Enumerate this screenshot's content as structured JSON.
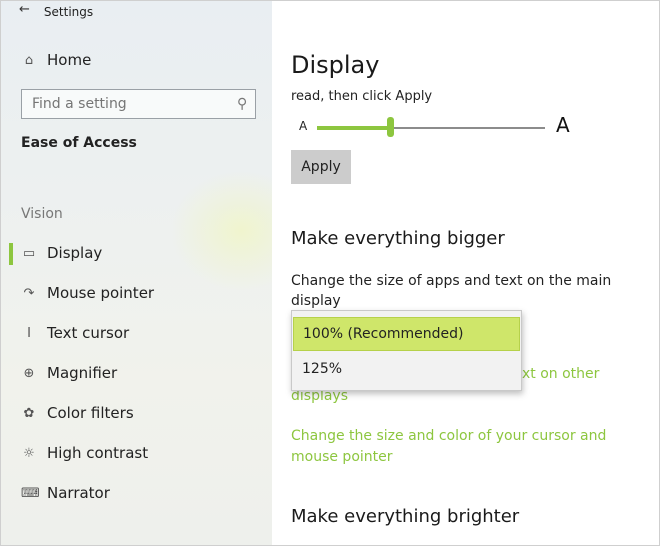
{
  "window": {
    "title": "Settings",
    "back_icon": "back-arrow-icon"
  },
  "sidebar": {
    "home_label": "Home",
    "search": {
      "placeholder": "Find a setting",
      "icon": "search-icon"
    },
    "section_label": "Ease of Access",
    "group_label": "Vision",
    "items": [
      {
        "label": "Display",
        "icon": "monitor-icon",
        "active": true
      },
      {
        "label": "Mouse pointer",
        "icon": "mouse-pointer-icon"
      },
      {
        "label": "Text cursor",
        "icon": "text-cursor-icon"
      },
      {
        "label": "Magnifier",
        "icon": "magnifier-icon"
      },
      {
        "label": "Color filters",
        "icon": "color-filters-icon"
      },
      {
        "label": "High contrast",
        "icon": "high-contrast-icon"
      },
      {
        "label": "Narrator",
        "icon": "narrator-icon"
      }
    ]
  },
  "main": {
    "title": "Display",
    "hint": "read, then click Apply",
    "slider": {
      "small_label": "A",
      "large_label": "A",
      "value_fraction": 0.32
    },
    "apply_label": "Apply",
    "bigger": {
      "heading": "Make everything bigger",
      "description": "Change the size of apps and text on the main display",
      "dropdown_options": [
        {
          "label": "100% (Recommended)",
          "selected": true
        },
        {
          "label": "125%",
          "selected": false
        }
      ],
      "link_other": "xt on other",
      "link_other_2": "displays",
      "link_cursor": "Change the size and color of your cursor and mouse pointer"
    },
    "brighter_heading": "Make everything brighter"
  },
  "colors": {
    "accent": "#8dc63f",
    "dropdown_highlight": "#cfe66a",
    "apply_bg": "#cccccc"
  }
}
